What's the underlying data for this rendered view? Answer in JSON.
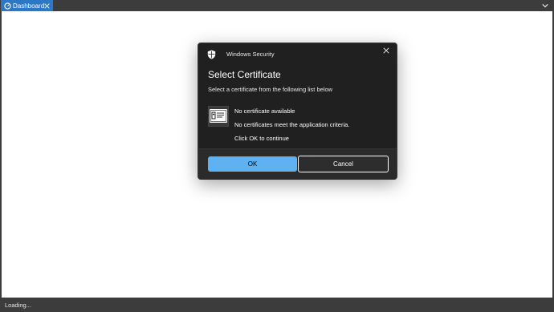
{
  "browser": {
    "tab_label": "Dashboard",
    "status_text": "Loading..."
  },
  "dialog": {
    "app_title": "Windows Security",
    "heading": "Select Certificate",
    "subheading": "Select a certificate from the following list below",
    "messages": [
      "No certificate available",
      "No certificates meet the application criteria.",
      "Click OK to continue"
    ],
    "ok_label": "OK",
    "cancel_label": "Cancel"
  },
  "colors": {
    "accent": "#5fb2f2",
    "tab": "#2b78c7",
    "dialog_bg": "#202020",
    "chrome": "#3c3c3c"
  },
  "icons": [
    "dashboard-icon",
    "close-icon",
    "chevron-down-icon",
    "shield-icon",
    "certificate-icon"
  ]
}
